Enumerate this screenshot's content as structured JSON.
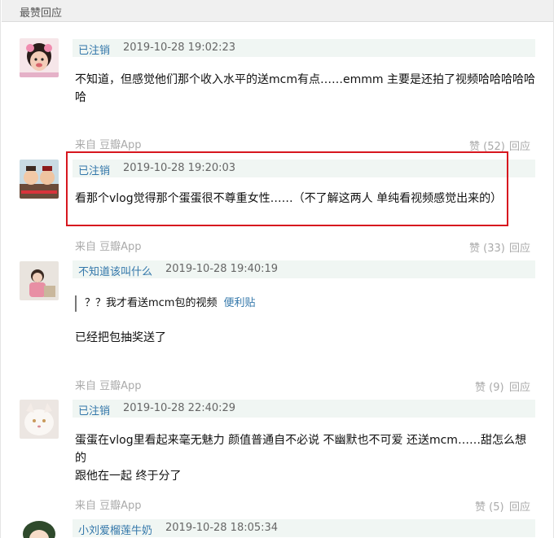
{
  "section": {
    "title": "最赞回应"
  },
  "comments": [
    {
      "author": "已注销",
      "time": "2019-10-28 19:02:23",
      "content_line1": "不知道，但感觉他们那个收入水平的送mcm有点……emmm 主要是还拍了视频哈哈哈哈哈",
      "content_line2": "哈",
      "source": "来自 豆瓣App",
      "vote": "赞 (52)",
      "reply": "回应",
      "avatar_icon": "girl-avatar-icon"
    },
    {
      "author": "已注销",
      "time": "2019-10-28 19:20:03",
      "content_line1": "看那个vlog觉得那个蛋蛋很不尊重女性……（不了解这两人 单纯看视频感觉出来的）",
      "source": "来自 豆瓣App",
      "vote": "赞 (33)",
      "reply": "回应",
      "avatar_icon": "cartoon-avatar-icon"
    },
    {
      "author": "不知道该叫什么",
      "time": "2019-10-28 19:40:19",
      "quote_text": "？？我才看送mcm包的视频",
      "quote_link": "便利贴",
      "content_line1": "已经把包抽奖送了",
      "source": "来自 豆瓣App",
      "vote": "赞 (9)",
      "reply": "回应",
      "avatar_icon": "child-avatar-icon"
    },
    {
      "author": "已注销",
      "time": "2019-10-28 22:40:29",
      "content_line1": "蛋蛋在vlog里看起来毫无魅力 颜值普通自不必说 不幽默也不可爱 还送mcm……甜怎么想的",
      "content_line2": "跟他在一起 终于分了",
      "source": "来自 豆瓣App",
      "vote": "赞 (5)",
      "reply": "回应",
      "avatar_icon": "cat-avatar-icon"
    },
    {
      "author": "小刘爱榴莲牛奶",
      "time": "2019-10-28 18:05:34",
      "avatar_icon": "cartoon-girl-avatar-icon"
    }
  ],
  "colors": {
    "link": "#3377aa",
    "meta_bg": "#f0f6f3",
    "highlight": "#d7171f",
    "muted": "#aaaaaa"
  }
}
